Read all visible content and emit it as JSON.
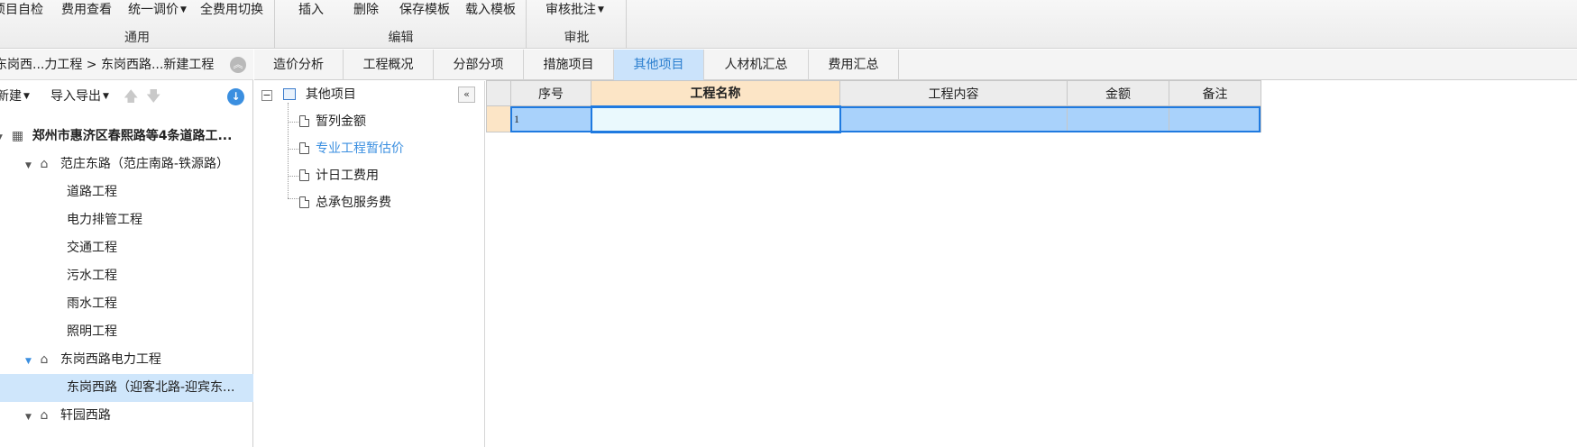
{
  "ribbon": {
    "groups": [
      {
        "label": "通用",
        "buttons": [
          "项目自检",
          "费用查看",
          "统一调价",
          "全费用切换"
        ]
      },
      {
        "label": "编辑",
        "buttons": [
          "插入",
          "删除",
          "保存模板",
          "载入模板"
        ]
      },
      {
        "label": "审批",
        "buttons": [
          "审核批注"
        ]
      }
    ]
  },
  "left": {
    "breadcrumb": "东岗西...力工程 > 东岗西路...新建工程",
    "toolbar": {
      "new": "新建",
      "import_export": "导入导出"
    },
    "tree": {
      "root": "郑州市惠济区春熙路等4条道路工...",
      "nodes": [
        "范庄东路（范庄南路-铁源路）",
        "道路工程",
        "电力排管工程",
        "交通工程",
        "污水工程",
        "雨水工程",
        "照明工程",
        "东岗西路电力工程",
        "东岗西路（迎客北路-迎宾东...",
        "轩园西路"
      ]
    }
  },
  "tabs": [
    "造价分析",
    "工程概况",
    "分部分项",
    "措施项目",
    "其他项目",
    "人材机汇总",
    "费用汇总"
  ],
  "active_tab": "其他项目",
  "mid_tree": {
    "root": "其他项目",
    "children": [
      "暂列金额",
      "专业工程暂估价",
      "计日工费用",
      "总承包服务费"
    ]
  },
  "grid": {
    "columns": [
      "序号",
      "工程名称",
      "工程内容",
      "金额",
      "备注"
    ],
    "rows": [
      [
        "1",
        "",
        "",
        "",
        ""
      ]
    ]
  },
  "colors": {
    "accent": "#3b8fe0",
    "selection": "#a9d2fb",
    "header_highlight": "#fce5c6"
  }
}
